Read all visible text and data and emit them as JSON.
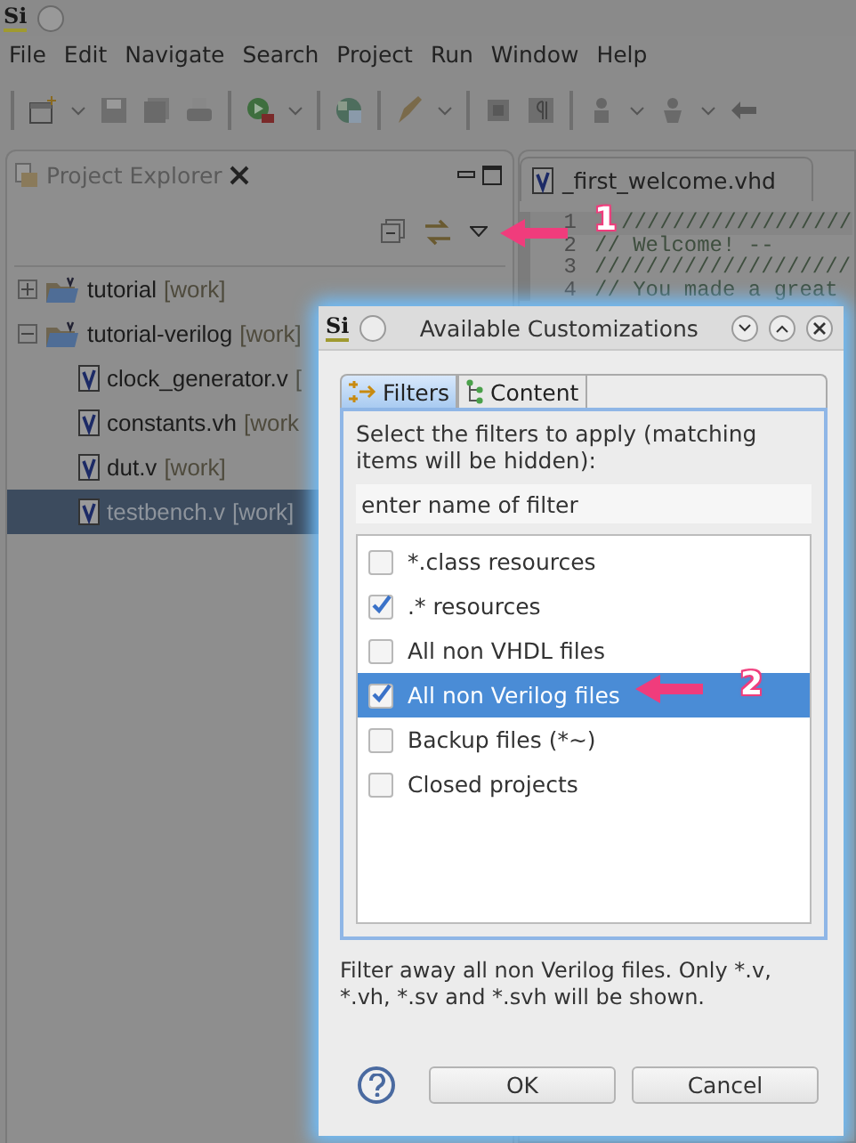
{
  "window": {
    "logo": "Si"
  },
  "menu": [
    "File",
    "Edit",
    "Navigate",
    "Search",
    "Project",
    "Run",
    "Window",
    "Help"
  ],
  "project_explorer": {
    "title": "Project Explorer",
    "items": [
      {
        "name": "tutorial",
        "tag": "[work]",
        "kind": "project",
        "expanded": false,
        "selected": false
      },
      {
        "name": "tutorial-verilog",
        "tag": "[work]",
        "kind": "project",
        "expanded": true,
        "selected": false,
        "children": [
          {
            "name": "clock_generator.v",
            "tag": "[",
            "kind": "file",
            "selected": false
          },
          {
            "name": "constants.vh",
            "tag": "[work",
            "kind": "file",
            "selected": false
          },
          {
            "name": "dut.v",
            "tag": "[work]",
            "kind": "file",
            "selected": false
          },
          {
            "name": "testbench.v",
            "tag": "[work]",
            "kind": "file",
            "selected": true
          }
        ]
      }
    ]
  },
  "editor": {
    "tabs": [
      {
        "label": "_first_welcome.vhd"
      }
    ],
    "lines": [
      {
        "number": "1",
        "text": "//////////////////"
      },
      {
        "number": "2",
        "text": "// Welcome! --"
      },
      {
        "number": "3",
        "text": "////////////////////"
      },
      {
        "number": "4",
        "text": "// You made a great"
      }
    ]
  },
  "dialog": {
    "logo": "Si",
    "title": "Available Customizations",
    "tabs": [
      {
        "label": "Filters",
        "selected": true
      },
      {
        "label": "Content",
        "selected": false
      }
    ],
    "instructions": "Select the filters to apply (matching items will be hidden):",
    "filter_field": {
      "placeholder": "enter name of filter"
    },
    "filters": [
      {
        "label": "*.class resources",
        "checked": false,
        "selected": false
      },
      {
        "label": ".* resources",
        "checked": true,
        "selected": false
      },
      {
        "label": "All non VHDL files",
        "checked": false,
        "selected": false
      },
      {
        "label": "All non Verilog files",
        "checked": true,
        "selected": true
      },
      {
        "label": "Backup files (*~)",
        "checked": false,
        "selected": false
      },
      {
        "label": "Closed projects",
        "checked": false,
        "selected": false
      }
    ],
    "description": "Filter away all non Verilog files. Only *.v, *.vh, *.sv and *.svh will be shown.",
    "buttons": [
      "OK",
      "Cancel"
    ]
  },
  "annotations": [
    {
      "label": "1"
    },
    {
      "label": "2"
    }
  ]
}
